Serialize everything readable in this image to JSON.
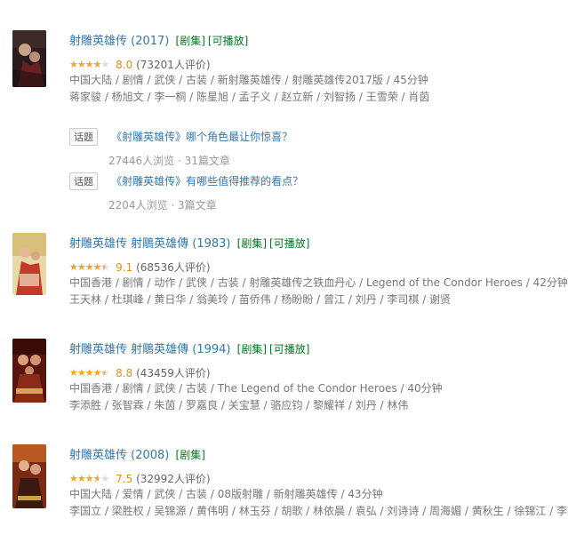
{
  "results": [
    {
      "title": "射雕英雄传 (2017)",
      "tags": [
        "[剧集]",
        "[可播放]"
      ],
      "rating": 8.0,
      "stars_fraction": 0.8,
      "score": "8.0",
      "count": "(73201人评价)",
      "meta1": "中国大陆 / 剧情 / 武侠 / 古装 / 新射雕英雄传 / 射雕英雄传2017版 / 45分钟",
      "meta2": "蒋家骏 / 杨旭文 / 李一桐 / 陈星旭 / 孟子义 / 赵立新 / 刘智扬 / 王雪荣 / 肖茵",
      "poster_icon": "poster-2017"
    },
    {
      "title": "射雕英雄传 射鵰英雄傳 (1983)",
      "tags": [
        "[剧集]",
        "[可播放]"
      ],
      "stars_fraction": 0.9,
      "score": "9.1",
      "count": "(68536人评价)",
      "meta1": "中国香港 / 剧情 / 动作 / 武侠 / 古装 / 射雕英雄传之铁血丹心 / Legend of the Condor Heroes / 42分钟",
      "meta2": "王天林 / 杜琪峰 / 黄日华 / 翁美玲 / 苗侨伟 / 杨盼盼 / 曾江 / 刘丹 / 李司棋 / 谢贤",
      "poster_icon": "poster-1983"
    },
    {
      "title": "射雕英雄传 射鵰英雄傳 (1994)",
      "tags": [
        "[剧集]",
        "[可播放]"
      ],
      "stars_fraction": 0.9,
      "score": "8.8",
      "count": "(43459人评价)",
      "meta1": "中国香港 / 剧情 / 武侠 / 古装 / The Legend of the Condor Heroes / 40分钟",
      "meta2": "李添胜 / 张智霖 / 朱茵 / 罗嘉良 / 关宝慧 / 骆应钧 / 黎耀祥 / 刘丹 / 林伟",
      "poster_icon": "poster-1994"
    },
    {
      "title": "射雕英雄传 (2008)",
      "tags": [
        "[剧集]"
      ],
      "stars_fraction": 0.75,
      "score": "7.5",
      "count": "(32992人评价)",
      "meta1": "中国大陆 / 爱情 / 武侠 / 古装 / 08版射雕 / 新射雕英雄传 / 43分钟",
      "meta2": "李国立 / 梁胜权 / 吴锦源 / 黄伟明 / 林玉芬 / 胡歌 / 林依晨 / 袁弘 / 刘诗诗 / 周海媚 / 黄秋生 / 徐锦江 / 李解",
      "poster_icon": "poster-2008"
    }
  ],
  "topics": [
    {
      "badge": "话题",
      "title": "《射雕英雄传》哪个角色最让你惊喜？",
      "stats": "27446人浏览 · 31篇文章"
    },
    {
      "badge": "话题",
      "title": "《射雕英雄传》有哪些值得推荐的看点？",
      "stats": "2204人浏览 · 3篇文章"
    }
  ],
  "stars_glyphs": "★★★★★",
  "colors": {
    "link": "#3377aa",
    "tag": "#007722",
    "star": "#f5a623",
    "score": "#e09015"
  }
}
